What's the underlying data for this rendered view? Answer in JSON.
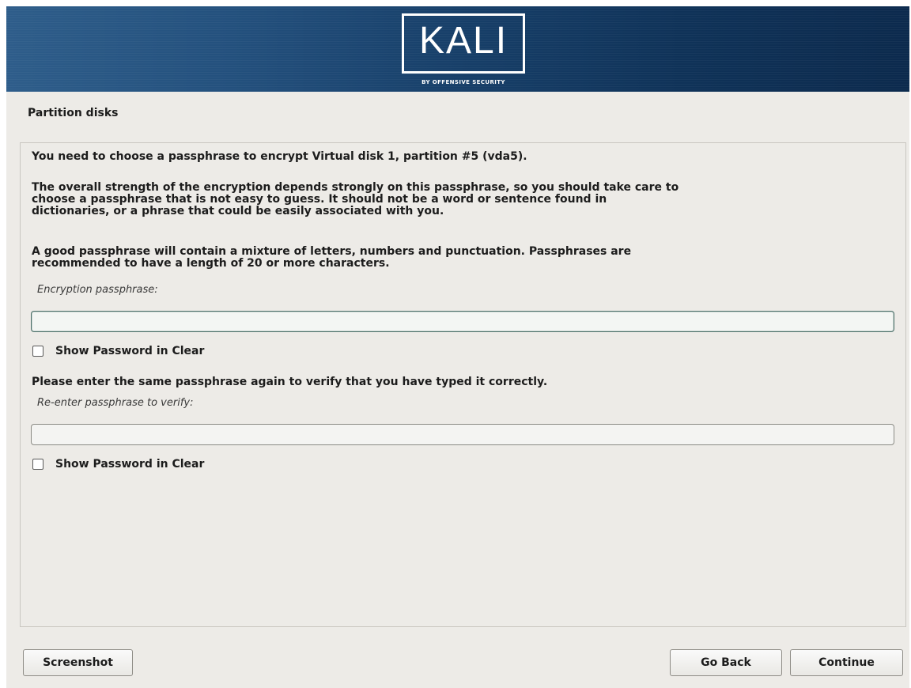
{
  "banner": {
    "logo_text": "KALI",
    "logo_subtitle": "BY OFFENSIVE SECURITY",
    "gradient_colors": [
      "#2e5d8a",
      "#0c2a4d"
    ]
  },
  "page": {
    "title": "Partition disks"
  },
  "content": {
    "intro": "You need to choose a passphrase to encrypt Virtual disk 1, partition #5 (vda5).",
    "strength_lines": [
      "The overall strength of the encryption depends strongly on this passphrase, so you should take care to",
      "choose a passphrase that is not easy to guess. It should not be a word or sentence found in",
      "dictionaries, or a phrase that could be easily associated with you."
    ],
    "advice_lines": [
      "A good passphrase will contain a mixture of letters, numbers and punctuation. Passphrases are",
      "recommended to have a length of 20 or more characters."
    ],
    "passphrase": {
      "label": "Encryption passphrase:",
      "value": "",
      "show_label": "Show Password in Clear",
      "show_checked": false
    },
    "verify_prompt": "Please enter the same passphrase again to verify that you have typed it correctly.",
    "verify": {
      "label": "Re-enter passphrase to verify:",
      "value": "",
      "show_label": "Show Password in Clear",
      "show_checked": false
    }
  },
  "buttons": {
    "screenshot": "Screenshot",
    "go_back": "Go Back",
    "continue": "Continue"
  },
  "colors": {
    "background": "#edebe7",
    "focus_border": "#4a6f68"
  }
}
